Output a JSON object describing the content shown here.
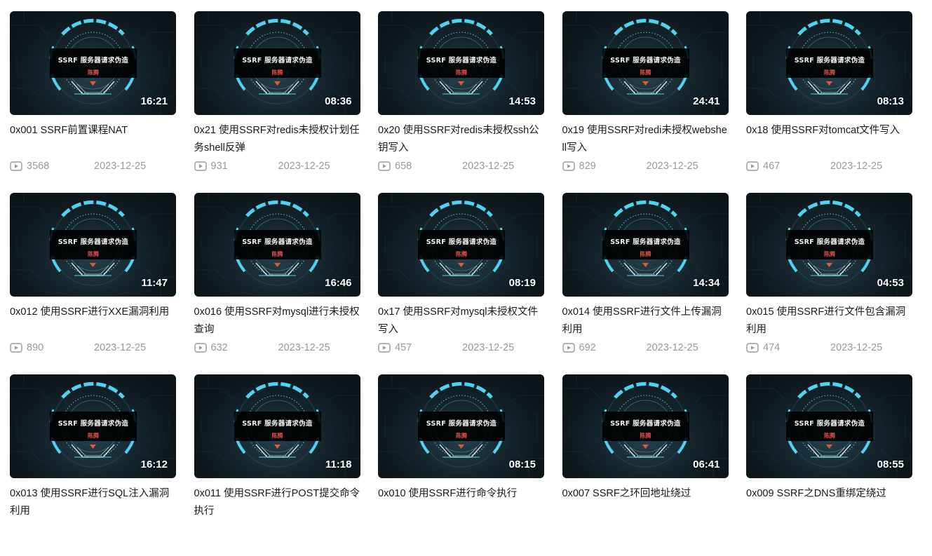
{
  "videos": [
    {
      "title": "0x001 SSRF前置课程NAT",
      "duration": "16:21",
      "views": "3568",
      "date": "2023-12-25"
    },
    {
      "title": "0x21 使用SSRF对redis未授权计划任务shell反弹",
      "duration": "08:36",
      "views": "931",
      "date": "2023-12-25"
    },
    {
      "title": "0x20 使用SSRF对redis未授权ssh公钥写入",
      "duration": "14:53",
      "views": "658",
      "date": "2023-12-25"
    },
    {
      "title": "0x19 使用SSRF对redi未授权webshell写入",
      "duration": "24:41",
      "views": "829",
      "date": "2023-12-25"
    },
    {
      "title": "0x18 使用SSRF对tomcat文件写入",
      "duration": "08:13",
      "views": "467",
      "date": "2023-12-25"
    },
    {
      "title": "0x012 使用SSRF进行XXE漏洞利用",
      "duration": "11:47",
      "views": "890",
      "date": "2023-12-25"
    },
    {
      "title": "0x016 使用SSRF对mysql进行未授权查询",
      "duration": "16:46",
      "views": "632",
      "date": "2023-12-25"
    },
    {
      "title": "0x17 使用SSRF对mysql未授权文件写入",
      "duration": "08:19",
      "views": "457",
      "date": "2023-12-25"
    },
    {
      "title": "0x014 使用SSRF进行文件上传漏洞利用",
      "duration": "14:34",
      "views": "692",
      "date": "2023-12-25"
    },
    {
      "title": "0x015 使用SSRF进行文件包含漏洞利用",
      "duration": "04:53",
      "views": "474",
      "date": "2023-12-25"
    },
    {
      "title": "0x013 使用SSRF进行SQL注入漏洞利用",
      "duration": "16:12",
      "views": "",
      "date": ""
    },
    {
      "title": "0x011 使用SSRF进行POST提交命令执行",
      "duration": "11:18",
      "views": "",
      "date": ""
    },
    {
      "title": "0x010 使用SSRF进行命令执行",
      "duration": "08:15",
      "views": "",
      "date": ""
    },
    {
      "title": "0x007 SSRF之环回地址绕过",
      "duration": "06:41",
      "views": "",
      "date": ""
    },
    {
      "title": "0x009 SSRF之DNS重绑定绕过",
      "duration": "08:55",
      "views": "",
      "date": ""
    }
  ],
  "thumbnail": {
    "banner_title": "SSRF  服务器请求伪造",
    "banner_author": "陈腾"
  },
  "icons": {
    "views": "play-count-icon"
  },
  "colors": {
    "title_text": "#18191c",
    "meta_text": "#9499a0",
    "ring_accent": "#4fd3f0",
    "author_accent": "#e0504a"
  }
}
